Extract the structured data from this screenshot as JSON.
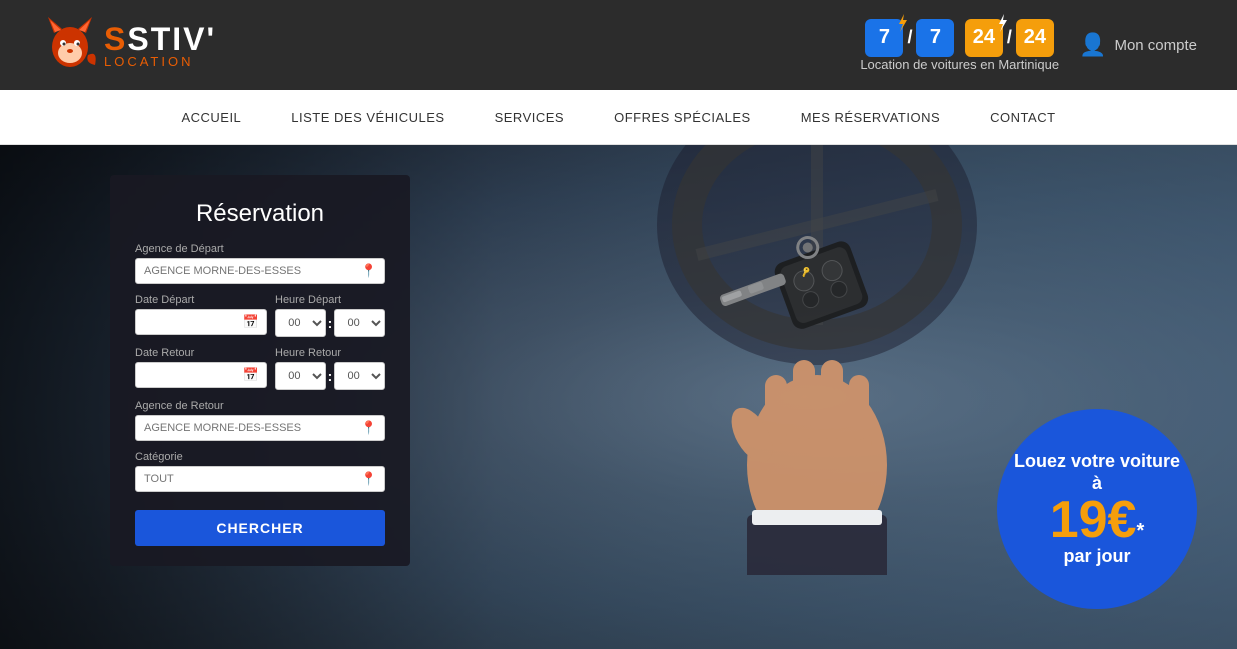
{
  "header": {
    "logo": {
      "brand": "STIV'",
      "subtitle": "Location",
      "tagline": "Location de voitures en Martinique"
    },
    "badges": {
      "seven": "7",
      "slash1": "/",
      "seven2": "7",
      "twentyfour": "24",
      "slash2": "/",
      "twentyfour2": "24",
      "subtitle": "Location de voitures en Martinique"
    },
    "account": {
      "label": "Mon compte"
    }
  },
  "navbar": {
    "items": [
      {
        "label": "ACCUEIL",
        "id": "accueil"
      },
      {
        "label": "LISTE DES VÉHICULES",
        "id": "liste"
      },
      {
        "label": "SERVICES",
        "id": "services"
      },
      {
        "label": "OFFRES SPÉCIALES",
        "id": "offres"
      },
      {
        "label": "MES RÉSERVATIONS",
        "id": "reservations"
      },
      {
        "label": "CONTACT",
        "id": "contact"
      }
    ]
  },
  "hero": {
    "form": {
      "title": "Réservation",
      "agence_depart_label": "Agence de Départ",
      "agence_depart_placeholder": "AGENCE MORNE-DES-ESSES",
      "date_depart_label": "Date Départ",
      "heure_depart_label": "Heure Départ",
      "heure_depart_h": "00",
      "heure_depart_m": "00",
      "date_retour_label": "Date Retour",
      "heure_retour_label": "Heure Retour",
      "heure_retour_h": "00",
      "heure_retour_m": "00",
      "agence_retour_label": "Agence de Retour",
      "agence_retour_placeholder": "AGENCE MORNE-DES-ESSES",
      "categorie_label": "Catégorie",
      "categorie_placeholder": "TOUT",
      "search_btn": "CHERCHER"
    },
    "promo": {
      "text_top": "Louez votre voiture à",
      "price": "19€",
      "asterisk": "*",
      "text_bottom": "par jour"
    }
  }
}
